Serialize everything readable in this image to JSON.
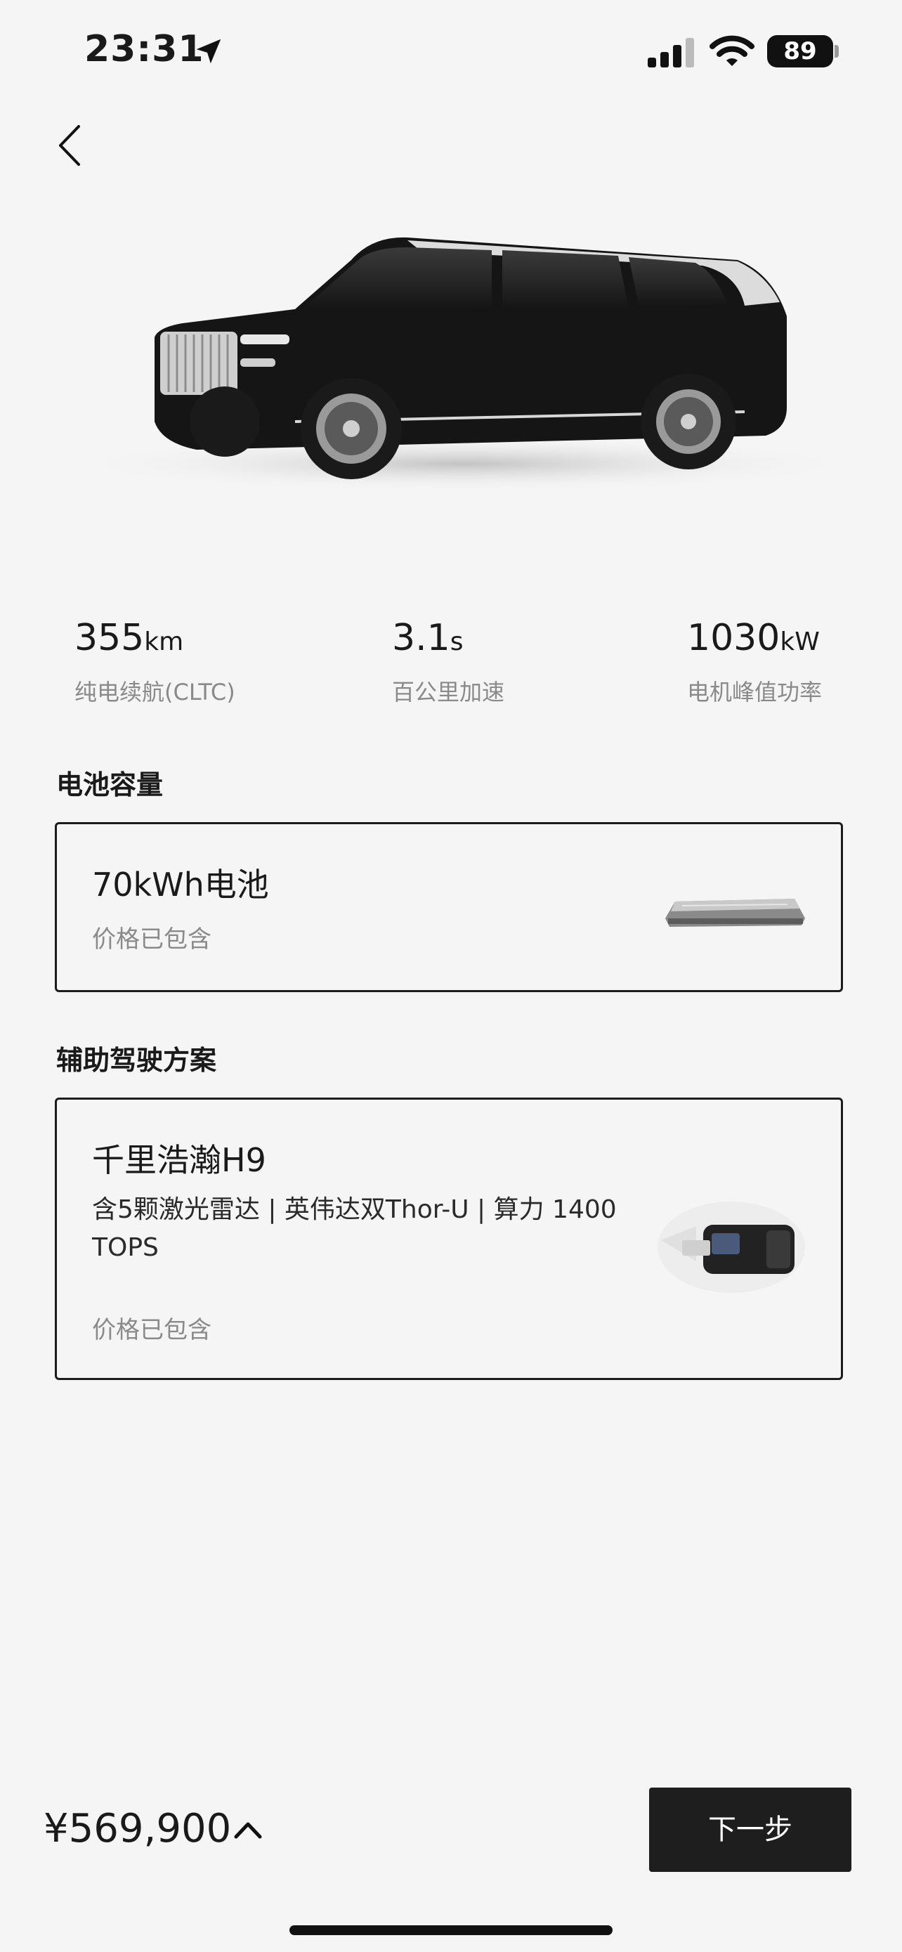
{
  "status_bar": {
    "time": "23:31",
    "battery": "89"
  },
  "specs": [
    {
      "value": "355",
      "unit": "km",
      "label": "纯电续航(CLTC)"
    },
    {
      "value": "3.1",
      "unit": "s",
      "label": "百公里加速"
    },
    {
      "value": "1030",
      "unit": "kW",
      "label": "电机峰值功率"
    }
  ],
  "battery_section": {
    "title": "电池容量",
    "card": {
      "title": "70kWh电池",
      "note": "价格已包含"
    }
  },
  "adas_section": {
    "title": "辅助驾驶方案",
    "card": {
      "title": "千里浩瀚H9",
      "desc": "含5颗激光雷达 | 英伟达双Thor-U | 算力 1400 TOPS",
      "note": "价格已包含"
    }
  },
  "footer": {
    "price": "¥569,900",
    "next_label": "下一步"
  },
  "colors": {
    "background": "#f5f5f5",
    "primary": "#1e1e1e",
    "muted": "#8a8a8a"
  },
  "icons": [
    "location-arrow-icon",
    "cellular-signal-icon",
    "wifi-icon",
    "battery-icon",
    "back-chevron-icon",
    "chevron-up-icon"
  ]
}
